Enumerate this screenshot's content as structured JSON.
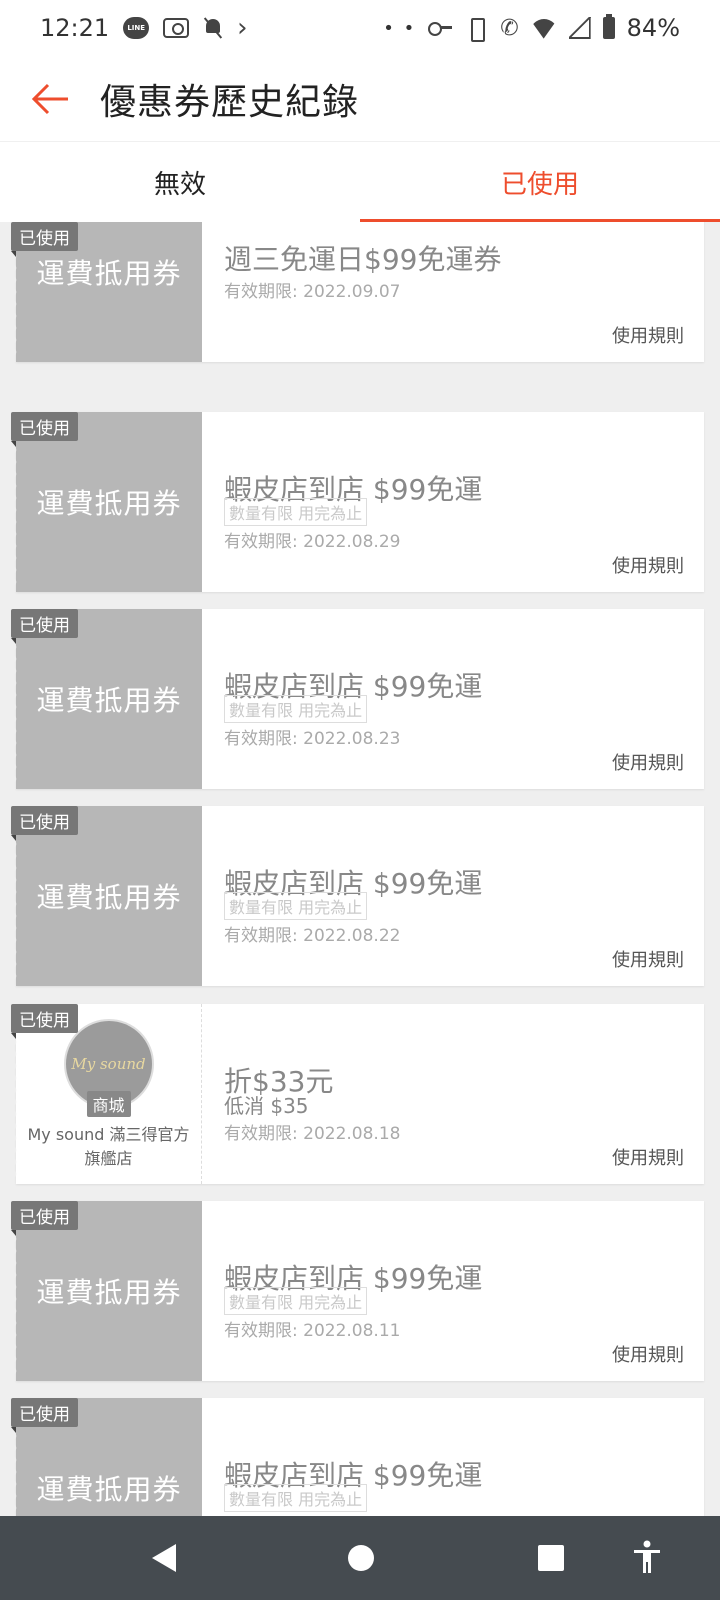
{
  "status_bar": {
    "time": "12:21",
    "battery": "84%",
    "left_icons": [
      "line-icon",
      "camera-icon",
      "bell-off-icon",
      "chevron-right-icon"
    ],
    "right_icons": [
      "dots-icon",
      "key-icon",
      "vibrate-icon",
      "wifi-call-icon",
      "wifi-icon",
      "signal-icon",
      "battery-icon"
    ]
  },
  "header": {
    "title": "優惠券歷史紀錄",
    "back_icon": "arrow-left-icon",
    "accent_color": "#ee4d2d"
  },
  "tabs": [
    {
      "label": "無效",
      "active": false
    },
    {
      "label": "已使用",
      "active": true
    }
  ],
  "coupons": [
    {
      "badge": "已使用",
      "stub_label": "運費抵用券",
      "title": "週三免運日$99免運券",
      "tag": "",
      "expiry": "有效期限: 2022.09.07",
      "rule": "使用規則"
    },
    {
      "badge": "已使用",
      "stub_label": "運費抵用券",
      "title": "蝦皮店到店 $99免運",
      "tag": "數量有限 用完為止",
      "expiry": "有效期限: 2022.08.29",
      "rule": "使用規則"
    },
    {
      "badge": "已使用",
      "stub_label": "運費抵用券",
      "title": "蝦皮店到店 $99免運",
      "tag": "數量有限 用完為止",
      "expiry": "有效期限: 2022.08.23",
      "rule": "使用規則"
    },
    {
      "badge": "已使用",
      "stub_label": "運費抵用券",
      "title": "蝦皮店到店 $99免運",
      "tag": "數量有限 用完為止",
      "expiry": "有效期限: 2022.08.22",
      "rule": "使用規則"
    },
    {
      "badge": "已使用",
      "shop_logo_text": "My sound",
      "mall_tag": "商城",
      "shop_name": "My sound 滿三得官方旗艦店",
      "title": "折$33元",
      "min_spend": "低消 $35",
      "expiry": "有效期限: 2022.08.18",
      "rule": "使用規則"
    },
    {
      "badge": "已使用",
      "stub_label": "運費抵用券",
      "title": "蝦皮店到店 $99免運",
      "tag": "數量有限 用完為止",
      "expiry": "有效期限: 2022.08.11",
      "rule": "使用規則"
    },
    {
      "badge": "已使用",
      "stub_label": "運費抵用券",
      "title": "蝦皮店到店 $99免運",
      "tag": "數量有限 用完為止",
      "expiry": "",
      "rule": ""
    }
  ],
  "nav_bar": {
    "icons": [
      "back-triangle-icon",
      "home-circle-icon",
      "recents-square-icon",
      "accessibility-icon"
    ]
  }
}
